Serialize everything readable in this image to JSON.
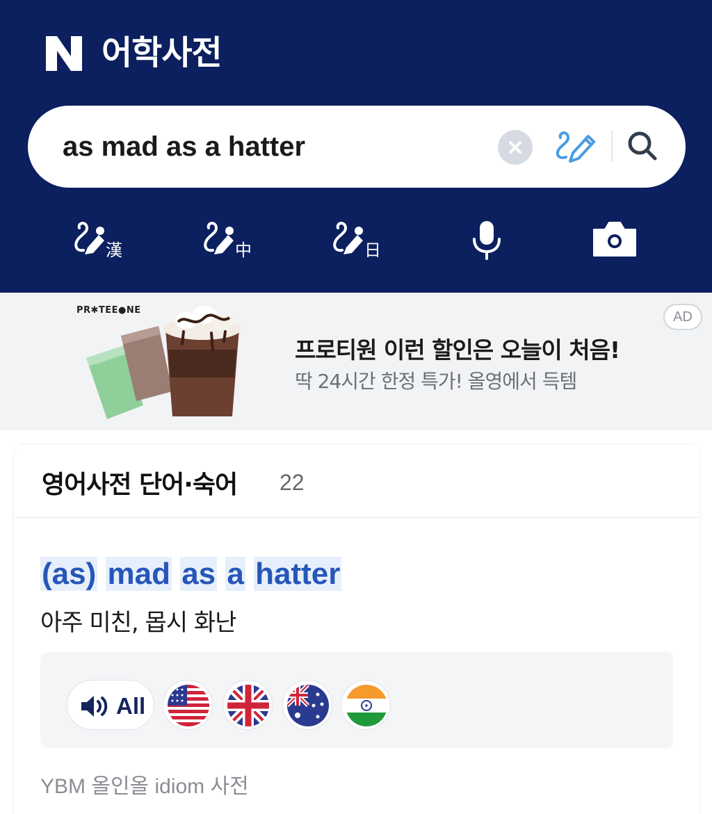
{
  "header": {
    "logo_text": "N",
    "app_title": "어학사전"
  },
  "search": {
    "query": "as mad as a hatter",
    "icons": [
      "clear-icon",
      "handwriting-pen-icon",
      "search-icon"
    ]
  },
  "toolbar": {
    "items": [
      {
        "name": "hanja-handwriting",
        "glyph": "漢"
      },
      {
        "name": "chinese-handwriting",
        "glyph": "中"
      },
      {
        "name": "japanese-handwriting",
        "glyph": "日"
      },
      {
        "name": "voice-search",
        "icon": "microphone-icon"
      },
      {
        "name": "image-search",
        "icon": "camera-icon"
      }
    ]
  },
  "ad": {
    "brand": "PR✱TEE●NE",
    "headline": "프로티원 이런 할인은 오늘이 처음!",
    "subtext": "딱 24시간 한정 특가! 올영에서 득템",
    "badge": "AD"
  },
  "result_section": {
    "title": "영어사전 단어·숙어",
    "count": "22",
    "entry": {
      "word_parts": [
        "(as)",
        "mad",
        "as",
        "a",
        "hatter"
      ],
      "meaning": "아주 미친, 몹시 화난",
      "pronunciation": {
        "all_label": "All",
        "flags": [
          "US",
          "UK",
          "AU",
          "IN"
        ]
      },
      "source": "YBM 올인올 idiom 사전"
    }
  },
  "colors": {
    "header_bg": "#0c1f5e",
    "link_blue": "#2656b8",
    "highlight": "#e6effb",
    "pen_blue": "#4a9be0"
  }
}
